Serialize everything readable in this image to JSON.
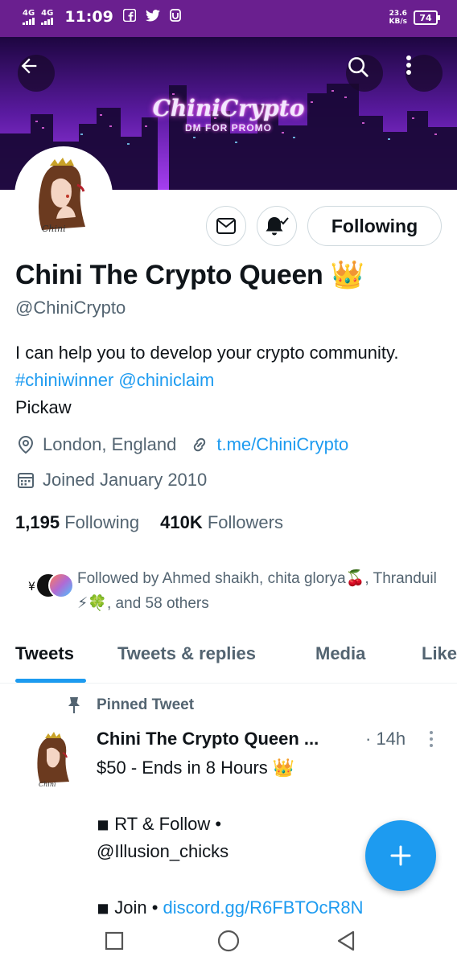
{
  "status_bar": {
    "network_1": "4G",
    "network_2": "4G",
    "time": "11:09",
    "speed_value": "23.6",
    "speed_unit": "KB/s",
    "battery": "74",
    "app_icons": [
      "facebook-icon",
      "twitter-icon",
      "shield-app-icon"
    ]
  },
  "banner": {
    "brand_text": "ChiniCrypto",
    "promo_text": "DM FOR PROMO"
  },
  "profile": {
    "avatar_label": "Chini",
    "name": "Chini The Crypto Queen",
    "name_emoji": "👑",
    "handle": "@ChiniCrypto",
    "bio_text": "I can help you to develop your crypto community. ",
    "bio_hashtag": "#chiniwinner",
    "bio_mention": "@chiniclaim",
    "bio_tail": "Pickaw",
    "location": "London, England",
    "website": "t.me/ChiniCrypto",
    "joined": "Joined January 2010",
    "following_count": "1,195",
    "following_label": "Following",
    "followers_count": "410K",
    "followers_label": "Followers",
    "followed_by": "Followed by Ahmed shaikh, chita glorya🍒, Thranduil ⚡🍀, and 58 others"
  },
  "actions": {
    "follow_label": "Following"
  },
  "tabs": [
    "Tweets",
    "Tweets & replies",
    "Media",
    "Like"
  ],
  "tweet": {
    "pinned_label": "Pinned Tweet",
    "author": "Chini The Crypto Queen ...",
    "time": "· 14h",
    "line1": "$50 - Ends in 8 Hours 👑",
    "line2": "◾ RT & Follow •",
    "line3": "@Illusion_chicks",
    "line4_prefix": "◾ Join • ",
    "line4_link": "discord.gg/R6FBTOcR8N"
  },
  "colors": {
    "accent": "#1d9bf0",
    "status_bar": "#6a1f8f",
    "secondary_text": "#536471"
  }
}
